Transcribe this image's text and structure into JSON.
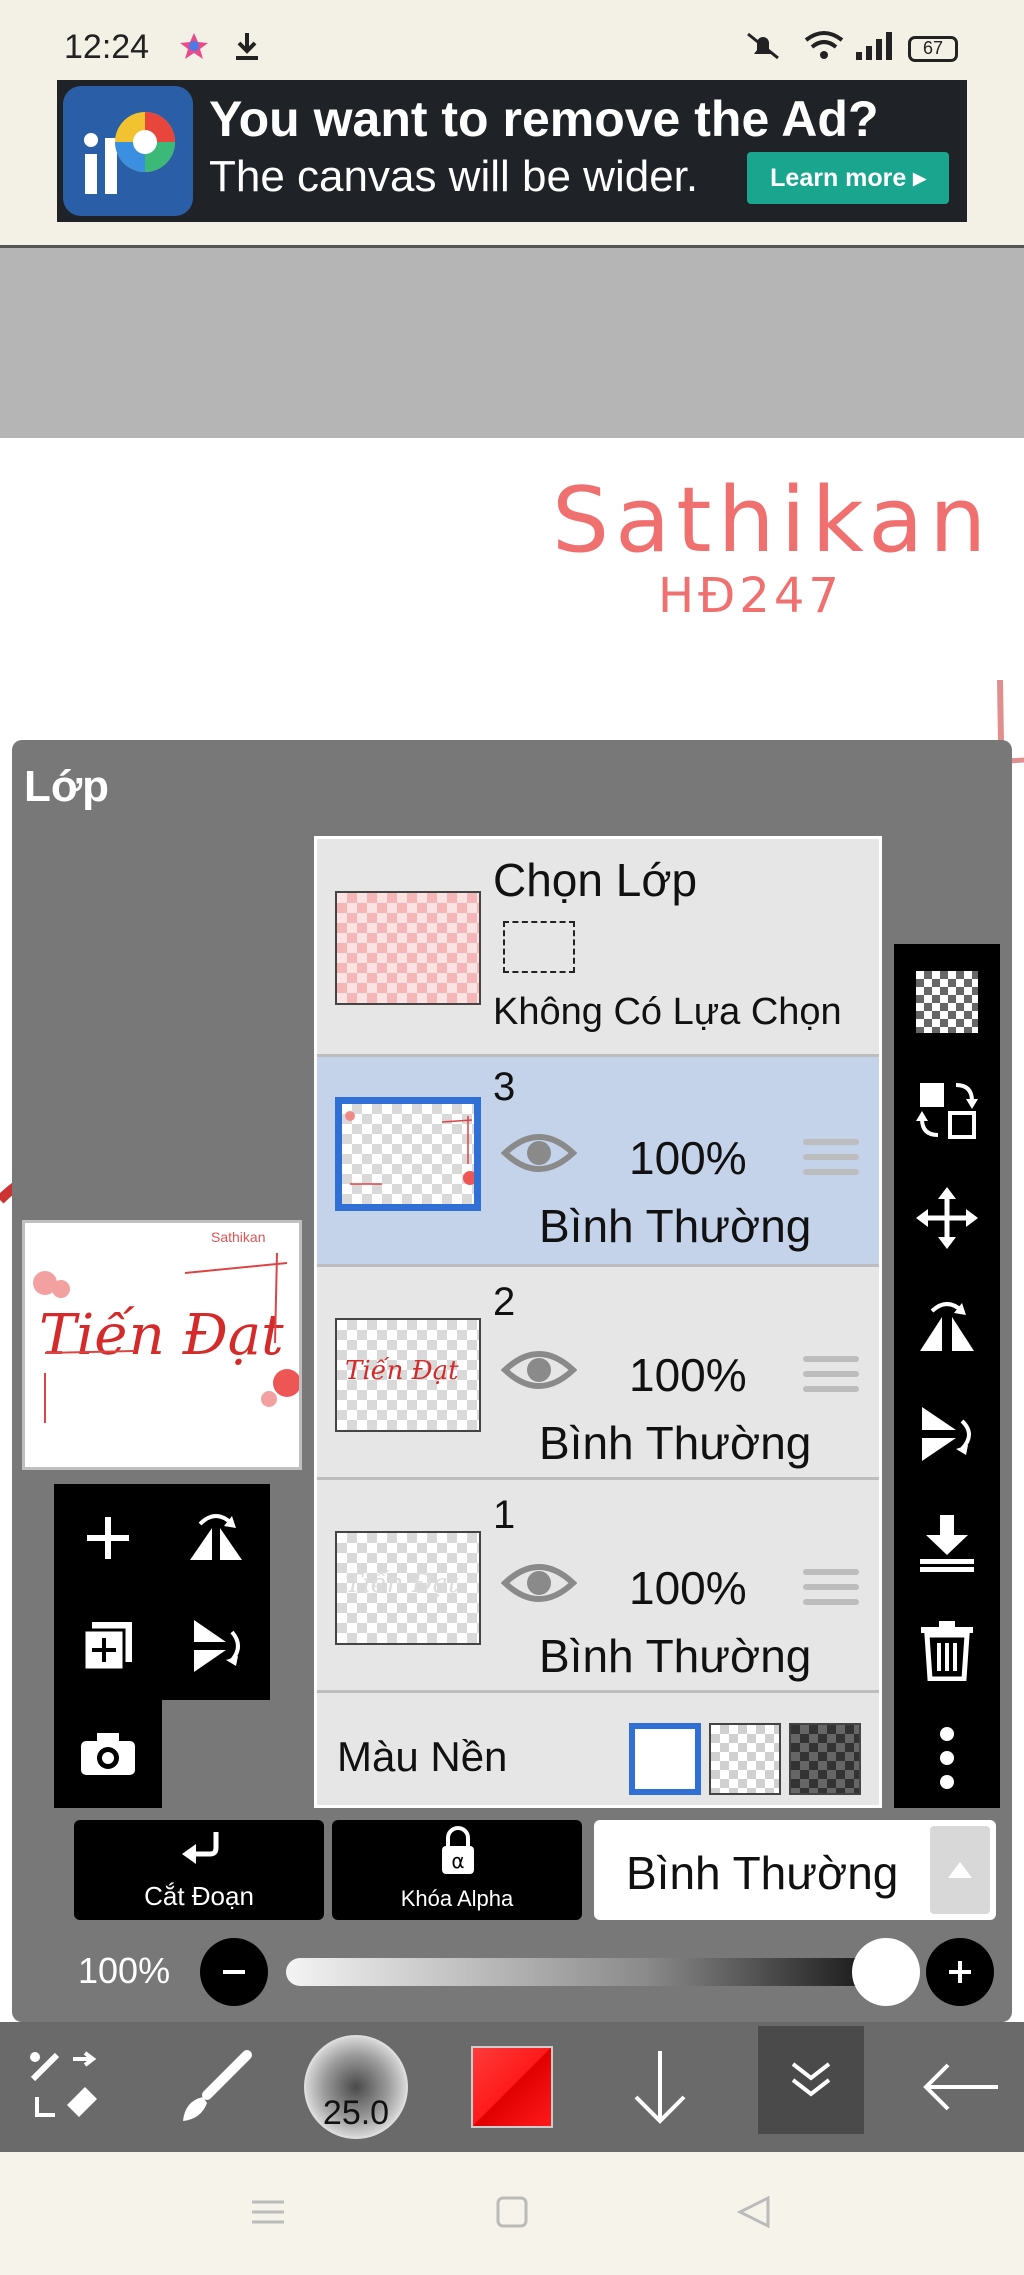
{
  "status_bar": {
    "time": "12:24",
    "battery": "67"
  },
  "ad": {
    "title": "You want to remove the Ad?",
    "subtitle": "The canvas will be wider.",
    "button": "Learn more"
  },
  "canvas": {
    "watermark_line1": "Sathikan",
    "watermark_line2": "HĐ247"
  },
  "panel": {
    "title": "Lớp",
    "preview_text": "Tiến Đạt",
    "preview_small": "Sathikan"
  },
  "selection": {
    "title": "Chọn Lớp",
    "status": "Không Có Lựa Chọn"
  },
  "layers": [
    {
      "number": "3",
      "opacity": "100%",
      "blend": "Bình Thường",
      "active": true
    },
    {
      "number": "2",
      "opacity": "100%",
      "blend": "Bình Thường",
      "active": false
    },
    {
      "number": "1",
      "opacity": "100%",
      "blend": "Bình Thường",
      "active": false
    }
  ],
  "background": {
    "label": "Màu Nền"
  },
  "actions": {
    "clipping": "Cắt Đoạn",
    "alpha_lock": "Khóa Alpha",
    "blend_mode": "Bình Thường"
  },
  "opacity": {
    "label": "100%",
    "value": 1.0
  },
  "toolbar": {
    "brush_size": "25.0",
    "color": "#ff1a1a"
  }
}
